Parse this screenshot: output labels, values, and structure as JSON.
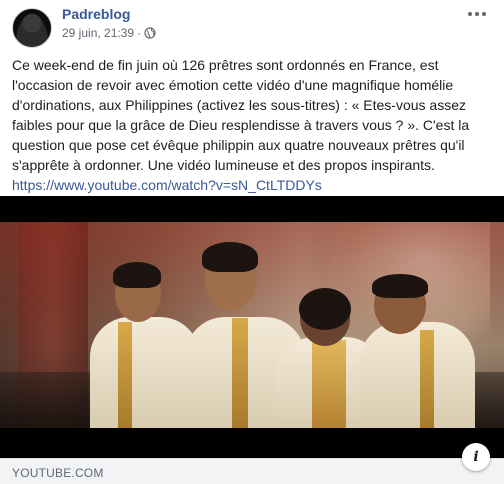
{
  "post": {
    "page_name": "Padreblog",
    "timestamp": "29 juin, 21:39",
    "separator": "·",
    "privacy_icon": "globe-icon",
    "more_icon": "ellipsis-icon",
    "text": "Ce week-end de fin juin où 126 prêtres sont ordonnés en France, est l'occasion de revoir avec émotion cette vidéo d'une magnifique homélie d'ordinations, aux Philippines (activez les sous-titres) : « Etes-vous assez faibles pour que la grâce de Dieu resplendisse à travers vous ? ». C'est la question que pose cet évêque philippin aux quatre nouveaux prêtres qu'il s'apprête à ordonner. Une vidéo lumineuse et des propos inspirants.",
    "link": "https://www.youtube.com/watch?v=sN_CtLTDDYs"
  },
  "media": {
    "source": "YOUTUBE.COM",
    "info_icon": "info-icon",
    "info_label": "i"
  },
  "colors": {
    "link": "#385898",
    "text": "#1c1e21",
    "meta": "#606770",
    "footer_bg": "#f2f3f5"
  }
}
